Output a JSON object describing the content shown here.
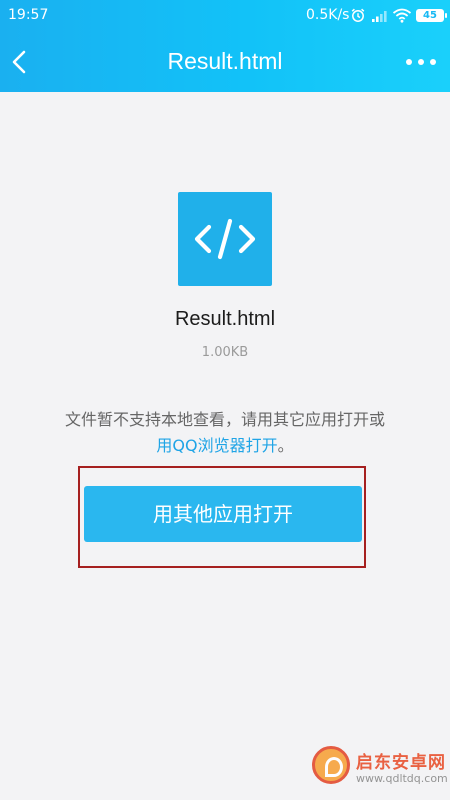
{
  "status_bar": {
    "time": "19:57",
    "network_speed": "0.5K/s",
    "battery": "45",
    "icons": [
      "alarm-icon",
      "signal-icon",
      "wifi-icon",
      "battery-icon"
    ]
  },
  "navbar": {
    "title": "Result.html",
    "back_icon": "chevron-left-icon",
    "more_icon": "more-dots-icon"
  },
  "file": {
    "name": "Result.html",
    "size": "1.00KB",
    "icon": "code-file-icon",
    "icon_glyph": "</>"
  },
  "notice": {
    "text_line1": "文件暂不支持本地查看，请用其它应用打开或",
    "link_text": "用QQ浏览器打开",
    "suffix": "。"
  },
  "actions": {
    "open_with_other_app_label": "用其他应用打开"
  },
  "watermark": {
    "name": "启东安卓网",
    "url": "www.qdltdq.com"
  },
  "colors": {
    "header_gradient": [
      "#1ab0f0",
      "#1ad0fb"
    ],
    "accent": "#2ab7ef",
    "link": "#1fa4e6",
    "highlight_border": "#a51f1f",
    "background": "#f3f3f5"
  }
}
